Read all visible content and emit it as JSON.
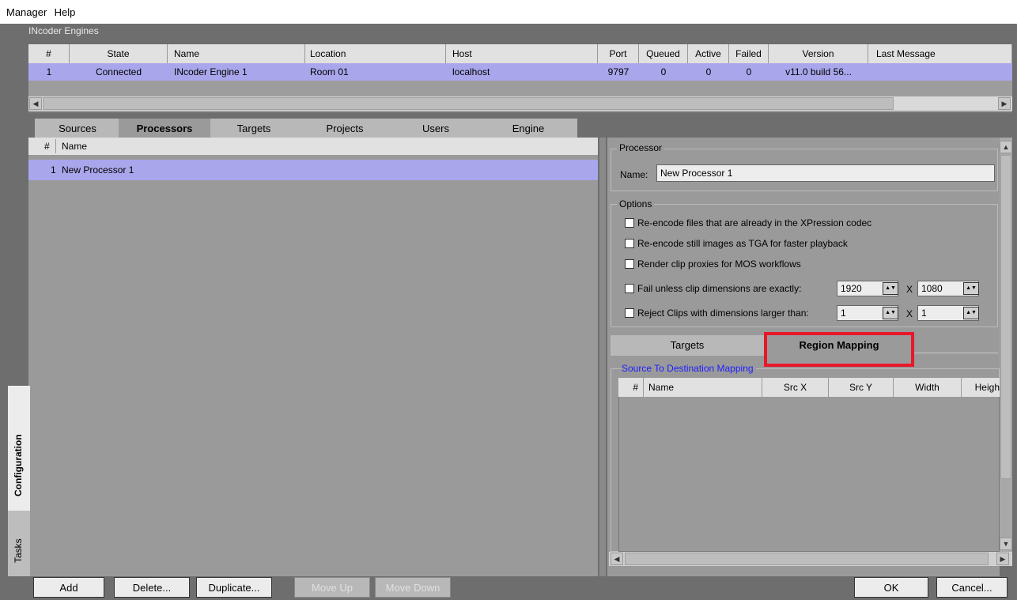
{
  "menu": {
    "items": [
      "Manager",
      "Help"
    ]
  },
  "engines": {
    "title": "INcoder Engines",
    "columns": [
      "#",
      "State",
      "Name",
      "Location",
      "Host",
      "Port",
      "Queued",
      "Active",
      "Failed",
      "Version",
      "Last Message"
    ],
    "rows": [
      [
        "1",
        "Connected",
        "INcoder Engine 1",
        "Room 01",
        "localhost",
        "9797",
        "0",
        "0",
        "0",
        "v11.0 build 56...",
        ""
      ]
    ]
  },
  "tabs": [
    "Sources",
    "Processors",
    "Targets",
    "Projects",
    "Users",
    "Engine"
  ],
  "active_tab": "Processors",
  "processors": {
    "columns": [
      "#",
      "Name"
    ],
    "rows": [
      [
        "1",
        "New Processor 1"
      ]
    ]
  },
  "side_tabs": [
    "Configuration",
    "Tasks"
  ],
  "buttons": {
    "add": "Add",
    "delete": "Delete...",
    "duplicate": "Duplicate...",
    "move_up": "Move Up",
    "move_down": "Move Down",
    "ok": "OK",
    "cancel": "Cancel..."
  },
  "processor": {
    "group_label": "Processor",
    "name_label": "Name:",
    "name_value": "New Processor 1"
  },
  "options": {
    "group_label": "Options",
    "reencode_codec": "Re-encode files that are already in the XPression codec",
    "reencode_tga": "Re-encode still images as TGA for faster playback",
    "render_proxies": "Render clip proxies for MOS workflows",
    "fail_unless": "Fail unless clip dimensions are exactly:",
    "fail_w": "1920",
    "fail_h": "1080",
    "reject_larger": "Reject Clips with dimensions larger than:",
    "reject_w": "1",
    "reject_h": "1",
    "x_sep": "X"
  },
  "sub_tabs": [
    "Targets",
    "Region Mapping"
  ],
  "active_sub_tab": "Region Mapping",
  "mapping": {
    "group_label": "Source To Destination Mapping",
    "columns": [
      "#",
      "Name",
      "Src X",
      "Src Y",
      "Width",
      "Heigh"
    ]
  },
  "colors": {
    "selection": "#a9a6eb",
    "highlight_box": "#e8182a",
    "panel": "#9a9a9a"
  }
}
